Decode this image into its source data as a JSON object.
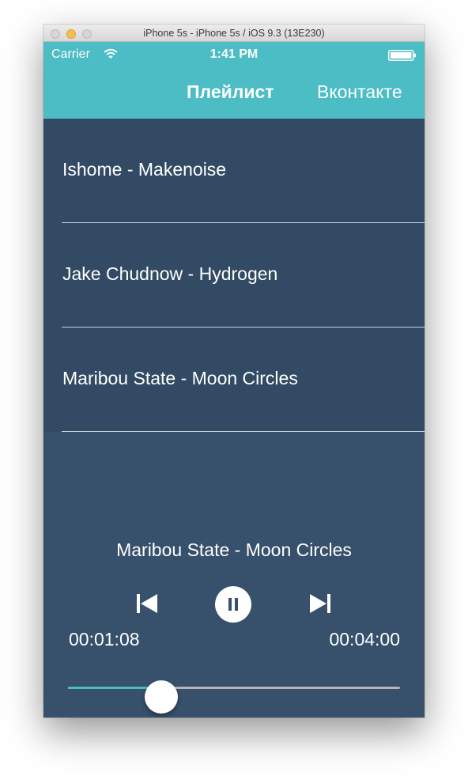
{
  "window": {
    "title": "iPhone 5s - iPhone 5s / iOS 9.3 (13E230)"
  },
  "status_bar": {
    "carrier": "Carrier",
    "time": "1:41 PM",
    "icons": [
      "wifi-icon",
      "battery-icon"
    ]
  },
  "nav": {
    "tabs": [
      {
        "label": "Плейлист",
        "active": true
      },
      {
        "label": "Вконтакте",
        "active": false
      }
    ]
  },
  "playlist": {
    "tracks": [
      {
        "title": "Ishome - Makenoise"
      },
      {
        "title": "Jake Chudnow - Hydrogen"
      },
      {
        "title": "Maribou State  - Moon Circles"
      }
    ]
  },
  "player": {
    "now_playing": "Maribou State  - Moon Circles",
    "elapsed": "00:01:08",
    "duration": "00:04:00",
    "progress": 0.28,
    "controls": [
      "previous-icon",
      "pause-icon",
      "next-icon"
    ]
  },
  "colors": {
    "nav_bg": "#4cbcc5",
    "list_bg": "#324a63",
    "player_bg": "#37506b",
    "accent": "#4cbcc5",
    "text": "#ffffff"
  }
}
